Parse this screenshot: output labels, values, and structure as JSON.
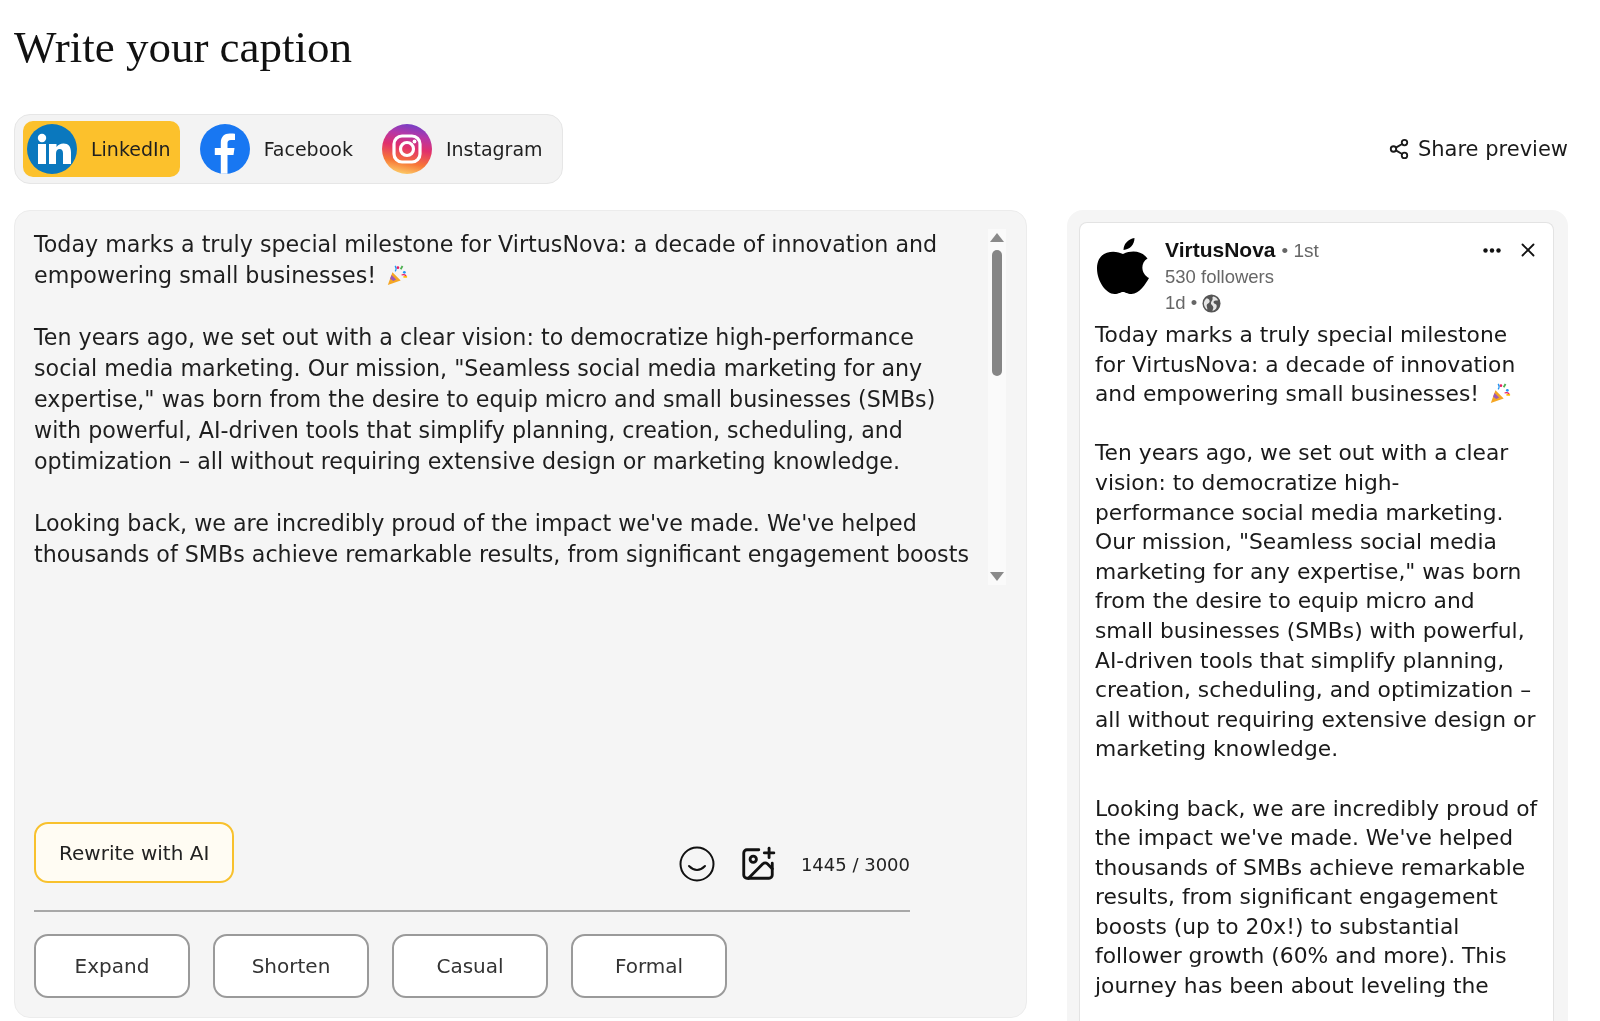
{
  "title": "Write your caption",
  "platform_tabs": [
    {
      "label": "LinkedIn",
      "kind": "linkedin",
      "selected": true
    },
    {
      "label": "Facebook",
      "kind": "facebook",
      "selected": false
    },
    {
      "label": "Instagram",
      "kind": "instagram",
      "selected": false
    }
  ],
  "share_button": {
    "label": "Share preview"
  },
  "editor": {
    "paragraphs": [
      {
        "text": "Today marks a truly special milestone for VirtusNova: a decade of innovation and empowering small businesses!",
        "emoji": true
      },
      {
        "text": "Ten years ago, we set out with a clear vision: to democratize high-performance social media marketing. Our mission, \"Seamless social media marketing for any expertise,\" was born from the desire to equip micro and small businesses (SMBs) with powerful, AI-driven tools that simplify planning, creation, scheduling, and optimization – all without requiring extensive design or marketing knowledge.",
        "emoji": false
      },
      {
        "text": "Looking back, we are incredibly proud of the impact we've made. We've helped thousands of SMBs achieve remarkable results, from significant engagement boosts",
        "emoji": false
      }
    ],
    "rewrite_button": "Rewrite with AI",
    "char_count": "1445 / 3000",
    "tone_buttons": [
      "Expand",
      "Shorten",
      "Casual",
      "Formal"
    ]
  },
  "preview": {
    "author": "VirtusNova",
    "connection": "• 1st",
    "followers": "530 followers",
    "posted": "1d •",
    "paragraphs": [
      {
        "text": "Today marks a truly special milestone for VirtusNova: a decade of innovation and empowering small businesses!",
        "emoji": true
      },
      {
        "text": "Ten years ago, we set out with a clear vision: to democratize high-performance social media marketing. Our mission, \"Seamless social media marketing for any expertise,\" was born from the desire to equip micro and small businesses (SMBs) with powerful, AI-driven tools that simplify planning, creation, scheduling, and optimization – all without requiring extensive design or marketing knowledge.",
        "emoji": false
      },
      {
        "text": "Looking back, we are incredibly proud of the impact we've made. We've helped thousands of SMBs achieve remarkable results, from significant engagement boosts (up to 20x!) to substantial follower growth (60% and more). This journey has been about leveling the",
        "emoji": false
      }
    ]
  }
}
